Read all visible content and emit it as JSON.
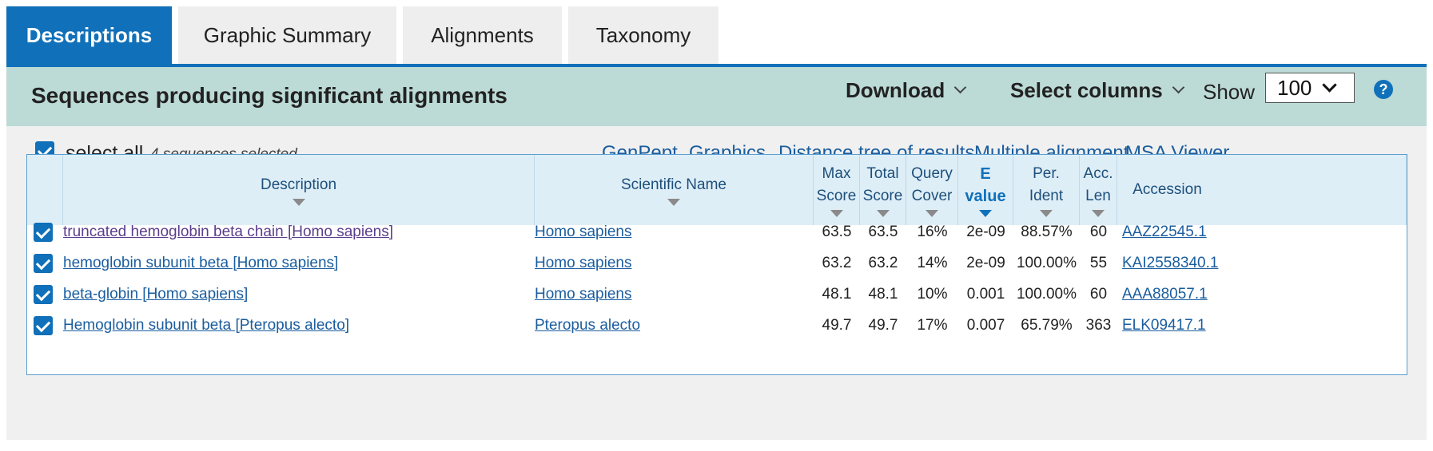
{
  "tabs": [
    {
      "label": "Descriptions",
      "active": true
    },
    {
      "label": "Graphic Summary",
      "active": false
    },
    {
      "label": "Alignments",
      "active": false
    },
    {
      "label": "Taxonomy",
      "active": false
    }
  ],
  "header": {
    "title": "Sequences producing significant alignments",
    "download_label": "Download",
    "select_columns_label": "Select columns",
    "show_label": "Show",
    "show_value": "100",
    "help_glyph": "?"
  },
  "selection": {
    "select_all_label": "select all",
    "selected_count": "4 sequences selected"
  },
  "links": {
    "genpept": "GenPept",
    "graphics": "Graphics",
    "distance_tree": "Distance tree of results",
    "multiple_alignment": "Multiple alignment",
    "msa_viewer": "MSA Viewer"
  },
  "columns": {
    "description": "Description",
    "scientific_name": "Scientific Name",
    "max_score": [
      "Max",
      "Score"
    ],
    "total_score": [
      "Total",
      "Score"
    ],
    "query_cover": [
      "Query",
      "Cover"
    ],
    "e_value": [
      "E",
      "value"
    ],
    "per_ident": [
      "Per.",
      "Ident"
    ],
    "acc_len": [
      "Acc.",
      "Len"
    ],
    "accession": "Accession"
  },
  "rows": [
    {
      "description": "truncated hemoglobin beta chain [Homo sapiens]",
      "scientific_name": "Homo sapiens",
      "max_score": "63.5",
      "total_score": "63.5",
      "query_cover": "16%",
      "e_value": "2e-09",
      "per_ident": "88.57%",
      "acc_len": "60",
      "accession": "AAZ22545.1"
    },
    {
      "description": "hemoglobin subunit beta [Homo sapiens]",
      "scientific_name": "Homo sapiens",
      "max_score": "63.2",
      "total_score": "63.2",
      "query_cover": "14%",
      "e_value": "2e-09",
      "per_ident": "100.00%",
      "acc_len": "55",
      "accession": "KAI2558340.1"
    },
    {
      "description": "beta-globin [Homo sapiens]",
      "scientific_name": "Homo sapiens",
      "max_score": "48.1",
      "total_score": "48.1",
      "query_cover": "10%",
      "e_value": "0.001",
      "per_ident": "100.00%",
      "acc_len": "60",
      "accession": "AAA88057.1"
    },
    {
      "description": "Hemoglobin subunit beta [Pteropus alecto]",
      "scientific_name": "Pteropus alecto",
      "max_score": "49.7",
      "total_score": "49.7",
      "query_cover": "17%",
      "e_value": "0.007",
      "per_ident": "65.79%",
      "acc_len": "363",
      "accession": "ELK09417.1"
    }
  ],
  "colors": {
    "accent": "#1070b9",
    "header_band": "#bcdad6",
    "link": "#1a5d9e",
    "visited_link": "#5b3d8c",
    "table_header": "#deeef7"
  }
}
